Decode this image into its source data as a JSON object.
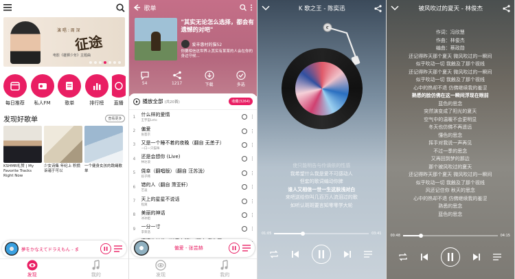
{
  "screen1": {
    "banner": {
      "small": "演 唱 : 周 深",
      "big": "征途",
      "sub": "电影《雄狮少年》主题曲"
    },
    "categories": [
      {
        "label": "每日推荐",
        "icon": "calendar-icon"
      },
      {
        "label": "私人FM",
        "icon": "radio-icon"
      },
      {
        "label": "歌单",
        "icon": "playlist-icon"
      },
      {
        "label": "排行榜",
        "icon": "chart-icon"
      },
      {
        "label": "直播",
        "icon": "live-icon"
      }
    ],
    "section_title": "发现好歌单",
    "section_more": "查看更多",
    "cards": [
      {
        "title": "KSHMR礼赞 | My Favorite Tracks Right Now"
      },
      {
        "title": "少女诗集 年纪上 积攒 诉诸于可以"
      },
      {
        "title": "一个健身女孩的跳绳歌单"
      }
    ],
    "mini_player_title": "夢をかなえてドラえもん - ま",
    "tabs": [
      {
        "label": "发现",
        "active": true
      },
      {
        "label": "我的",
        "active": false
      }
    ],
    "accent": "#e91e63"
  },
  "screen2": {
    "title": "歌单",
    "quote": "\"其实无论怎么选择，都会有遗憾的对吧\"",
    "uploader": "爱丰惠村的猫52",
    "description": "你要相信这世界上其实有某某的人会在你的身边守候...",
    "actions": [
      {
        "label": "54",
        "icon": "comment-icon"
      },
      {
        "label": "1217",
        "icon": "share-icon"
      },
      {
        "label": "下载",
        "icon": "download-icon"
      },
      {
        "label": "多选",
        "icon": "check-icon"
      }
    ],
    "play_all": "播放全部",
    "count": "(共20首)",
    "collect": "收藏(3264)",
    "songs": [
      {
        "no": "1",
        "title": "什么样的爱情",
        "artist": "王宇宙Leto"
      },
      {
        "no": "2",
        "title": "偏爱",
        "artist": "张芸京"
      },
      {
        "no": "3",
        "title": "又是一个睡不着的夜晚（翻自 无恙子）",
        "artist": "一口一只猫咪"
      },
      {
        "no": "4",
        "title": "还是会想你 (Live)",
        "artist": "林达浪"
      },
      {
        "no": "5",
        "title": "侥幸（翻唱版）（翻自 汪苏泷）",
        "artist": "段子韩"
      },
      {
        "no": "6",
        "title": "错的人（翻自 萧亚轩）",
        "artist": "艺凌"
      },
      {
        "no": "7",
        "title": "天上的星星不说话",
        "artist": "程爽"
      },
      {
        "no": "8",
        "title": "美丽的神话",
        "artist": "冰冰姐"
      },
      {
        "no": "9",
        "title": "一分一寸",
        "artist": "李荣浩"
      },
      {
        "no": "10",
        "title": "滚滚的长卷（抖音女版）（翻自 秦牛正",
        "artist": "叶问"
      }
    ],
    "now_playing": "偏爱 - 张芸赫",
    "tabs": [
      {
        "label": "发现"
      },
      {
        "label": "我的"
      }
    ]
  },
  "screen3": {
    "title": "K 歌之王 - 陈奕迅",
    "lyrics": [
      {
        "text": "使只能明告与伶谪依的性感",
        "state": "dim"
      },
      {
        "text": "我希望什么我是爱不可感动人",
        "state": "normal"
      },
      {
        "text": "但套的歌词编动你脾",
        "state": "normal"
      },
      {
        "text": "谁人又相信一世一生这肤浅对白",
        "state": "cur"
      },
      {
        "text": "来吧送给你叫几百万人流泪过的歌",
        "state": "normal"
      },
      {
        "text": "如听认斑斑要言知零零学大轮",
        "state": "normal"
      },
      {
        "text": "",
        "state": "dim"
      }
    ],
    "time_current": "01:05",
    "time_total": "03:41",
    "progress": 0.3
  },
  "screen4": {
    "title": "被风吹过的夏天 - 林俊杰",
    "lyrics": [
      {
        "text": "作词：冯欣慧",
        "state": "normal"
      },
      {
        "text": "作曲：林俊杰",
        "state": "normal"
      },
      {
        "text": "编曲：蔡政勋",
        "state": "normal"
      },
      {
        "text": "还记得昨天那个夏天 微风吹过的一瞬间",
        "state": "normal"
      },
      {
        "text": "似乎吹动一切 我触及了那个视线",
        "state": "normal"
      },
      {
        "text": "还记得昨天那个夏天 微风吹过的一瞬间",
        "state": "normal"
      },
      {
        "text": "似乎吹动一切 我触及了那个视线",
        "state": "normal"
      },
      {
        "text": "心中的热却不退 仿佛继续我的羞涩",
        "state": "normal"
      },
      {
        "text": "熟悉的脸仿佛在这一瞬间浮现在眼前",
        "state": "cur"
      },
      {
        "text": "蓝色的思念",
        "state": "normal"
      },
      {
        "text": "突然演变成了阳光的夏天",
        "state": "normal"
      },
      {
        "text": "空气中的温暖不会更明显",
        "state": "normal"
      },
      {
        "text": "冬天也仿佛不再遥远",
        "state": "normal"
      },
      {
        "text": "懂色的思念",
        "state": "normal"
      },
      {
        "text": "挥手对我说一声再见",
        "state": "normal"
      },
      {
        "text": "不过一季的思念",
        "state": "normal"
      },
      {
        "text": "又再回到梦的那边",
        "state": "normal"
      },
      {
        "text": "那个被风吹过的夏天",
        "state": "normal"
      },
      {
        "text": "还记得昨天那个夏天 微风吹过的一瞬间",
        "state": "normal"
      },
      {
        "text": "似乎吹动一切 我触及了那个视线",
        "state": "normal"
      },
      {
        "text": "风还记住你 秋天的思念",
        "state": "normal"
      },
      {
        "text": "心中的热却不退 仿佛继续我的羞涩",
        "state": "normal"
      },
      {
        "text": "熟悉的思念",
        "state": "normal"
      },
      {
        "text": "蓝色的思念",
        "state": "normal"
      }
    ],
    "time_current": "00:48",
    "time_total": "04:15",
    "progress": 0.19
  }
}
